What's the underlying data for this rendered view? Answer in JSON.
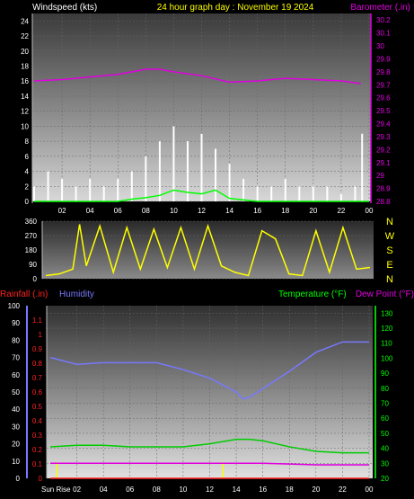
{
  "chart_data": [
    {
      "type": "line",
      "title": "24 hour graph day : November 19 2024",
      "left_axis": {
        "label": "Windspeed (kts)",
        "ylim": [
          0,
          25
        ],
        "ticks": [
          "0",
          "2",
          "4",
          "6",
          "8",
          "10",
          "12",
          "14",
          "16",
          "18",
          "20",
          "22",
          "24"
        ]
      },
      "right_axis": {
        "label": "Barometer (.in)",
        "ylim": [
          28.8,
          30.25
        ],
        "ticks": [
          "28.8",
          "28.9",
          "29",
          "29.1",
          "29.2",
          "29.3",
          "29.4",
          "29.5",
          "29.6",
          "29.7",
          "29.8",
          "29.9",
          "30",
          "30.1",
          "30.2"
        ]
      },
      "x_ticks": [
        "02",
        "04",
        "06",
        "08",
        "10",
        "12",
        "14",
        "16",
        "18",
        "20",
        "22",
        "00"
      ],
      "series": [
        {
          "name": "Barometer (.in)",
          "axis": "right",
          "color": "#e000e0",
          "x": [
            0,
            2,
            4,
            6,
            8,
            9,
            10,
            12,
            14,
            16,
            18,
            20,
            22,
            23.4
          ],
          "y": [
            29.73,
            29.74,
            29.76,
            29.78,
            29.82,
            29.82,
            29.8,
            29.77,
            29.72,
            29.73,
            29.75,
            29.74,
            29.73,
            29.71
          ]
        },
        {
          "name": "Windspeed gust",
          "axis": "left",
          "color": "#ffffff",
          "x": [
            0,
            1,
            2,
            3,
            4,
            5,
            6,
            7,
            8,
            9,
            10,
            11,
            12,
            13,
            14,
            15,
            16,
            17,
            18,
            19,
            20,
            21,
            22,
            23,
            23.5
          ],
          "y": [
            2,
            4,
            3,
            2,
            3,
            2,
            3,
            4,
            6,
            8,
            10,
            8,
            9,
            7,
            5,
            3,
            2,
            2,
            3,
            2,
            2,
            2,
            1,
            2,
            9
          ]
        },
        {
          "name": "Windspeed average",
          "axis": "left",
          "color": "#00ff00",
          "x": [
            0,
            4,
            6,
            7,
            8,
            9,
            10,
            11,
            12,
            13,
            14,
            16,
            24
          ],
          "y": [
            0,
            0,
            0,
            0.3,
            0.5,
            0.8,
            1.5,
            1.2,
            1.0,
            1.5,
            0.4,
            0,
            0
          ]
        }
      ]
    },
    {
      "type": "line",
      "right_labels": [
        "N",
        "W",
        "S",
        "E",
        "N"
      ],
      "left_axis": {
        "ylim": [
          0,
          360
        ],
        "ticks": [
          "0",
          "90",
          "180",
          "270",
          "360"
        ]
      },
      "series": [
        {
          "name": "Wind direction",
          "color": "#ffff00",
          "x": [
            0,
            1,
            2,
            2.5,
            3,
            4,
            5,
            6,
            7,
            8,
            9,
            10,
            11,
            12,
            13,
            14,
            15,
            16,
            17,
            18,
            19,
            20,
            21,
            22,
            23,
            24
          ],
          "y": [
            20,
            30,
            60,
            340,
            80,
            330,
            40,
            320,
            60,
            310,
            70,
            320,
            60,
            330,
            80,
            40,
            20,
            300,
            250,
            30,
            20,
            300,
            40,
            320,
            60,
            70
          ]
        }
      ]
    },
    {
      "type": "line",
      "legend": [
        "Rainfall (.in)",
        "Humidity",
        "Temperature (°F)",
        "Dew Point (°F)"
      ],
      "humidity_axis": {
        "ylim": [
          0,
          100
        ],
        "ticks": [
          "0",
          "10",
          "20",
          "30",
          "40",
          "50",
          "60",
          "70",
          "80",
          "90",
          "100"
        ]
      },
      "rain_axis": {
        "ylim": [
          0,
          1.2
        ],
        "ticks": [
          "0",
          "0.1",
          "0.2",
          "0.3",
          "0.4",
          "0.5",
          "0.6",
          "0.7",
          "0.8",
          "0.9",
          "1",
          "1.1"
        ]
      },
      "temp_axis": {
        "ylim": [
          20,
          135
        ],
        "ticks": [
          "20",
          "30",
          "40",
          "50",
          "60",
          "70",
          "80",
          "90",
          "100",
          "110",
          "120",
          "130"
        ]
      },
      "x_ticks": [
        "Sun Rise",
        "02",
        "04",
        "06",
        "08",
        "10",
        "12",
        "14",
        "16",
        "18",
        "20",
        "22",
        "00"
      ],
      "series": [
        {
          "name": "Humidity",
          "axis": "humidity",
          "color": "#7878ff",
          "x": [
            0,
            1,
            2,
            4,
            6,
            8,
            10,
            12,
            13,
            14,
            14.5,
            15,
            16,
            18,
            20,
            22,
            24
          ],
          "y": [
            70,
            68,
            66,
            67,
            67,
            67,
            63,
            58,
            54,
            50,
            46,
            47,
            52,
            62,
            73,
            79,
            79
          ]
        },
        {
          "name": "Temperature (°F)",
          "axis": "temp",
          "color": "#00cc00",
          "x": [
            0,
            2,
            4,
            6,
            8,
            10,
            12,
            14,
            15,
            16,
            18,
            20,
            22,
            24
          ],
          "y": [
            41,
            42,
            42,
            41,
            41,
            41,
            43,
            46,
            46,
            45,
            41,
            38,
            37,
            37
          ]
        },
        {
          "name": "Dew Point (°F)",
          "axis": "temp",
          "color": "#e000e0",
          "x": [
            0,
            4,
            8,
            12,
            16,
            20,
            24
          ],
          "y": [
            30,
            30,
            30,
            30,
            30,
            29,
            29
          ]
        },
        {
          "name": "Rainfall (.in)",
          "axis": "rain",
          "color": "#ff2020",
          "x": [
            0,
            24
          ],
          "y": [
            0,
            0
          ]
        }
      ]
    }
  ],
  "colors": {
    "wind_label": "#ffffff",
    "title": "#ffff00",
    "barometer": "#e000e0",
    "rainfall": "#ff2020",
    "humidity": "#7878ff",
    "temperature": "#00ff00",
    "dewpoint": "#e000e0",
    "direction": "#ffff00",
    "compass": "#ffff00"
  }
}
